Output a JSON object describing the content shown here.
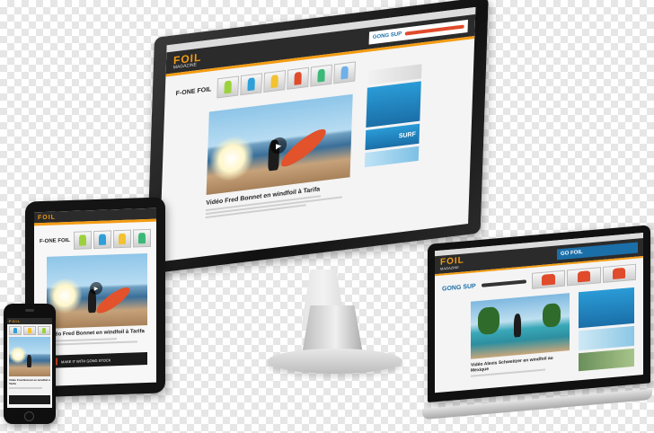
{
  "site": {
    "logo": "FOIL",
    "logo_sub": "MAGAZINE",
    "brand": "F-ONE FOIL",
    "banner_brand": "GONG SUP",
    "banner_foil": "GO FOIL",
    "ad_surf": "SURF",
    "ad_phone": "MAKE IT WITH GONG STOCK"
  },
  "articles": {
    "fred_bonnet": "Vidéo Fred Bonnet en windfoil à Tarifa",
    "fred_bonnet_short": "Vidéo Fred Bonnet en windfoil à Tarifa",
    "foil_schweitzer": "Vidéo Alexis Schweitzer en windfoil au Mexique"
  },
  "colors": {
    "accent": "#f39c12",
    "header": "#2b2b2b",
    "ad_blue": "#1b6fa8"
  },
  "icons": [
    "play-icon"
  ]
}
